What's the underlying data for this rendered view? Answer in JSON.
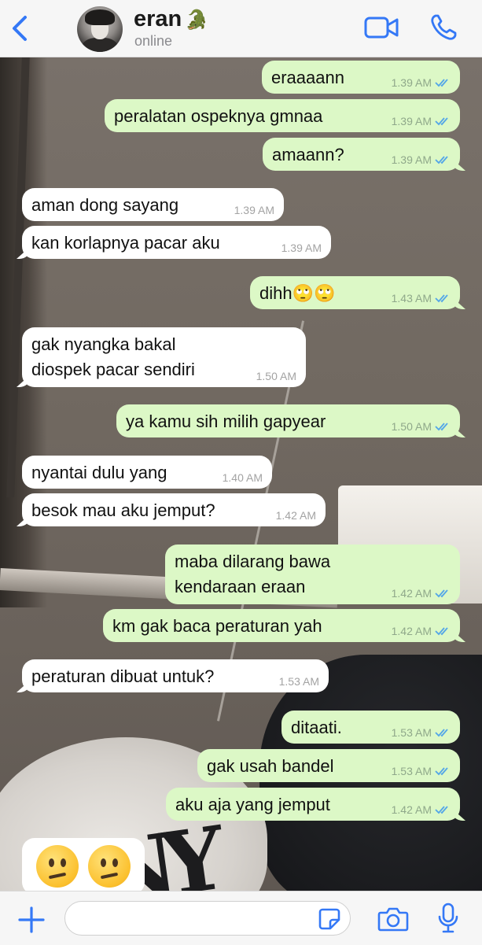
{
  "header": {
    "contact_name": "eran",
    "contact_name_emoji": "🐊",
    "status": "online",
    "icons": [
      "back-chevron-icon",
      "video-call-icon",
      "phone-call-icon"
    ],
    "accent_color": "#3478f6"
  },
  "messages": [
    {
      "direction": "out",
      "text": "eraaaann",
      "time": "1.39 AM",
      "read": true
    },
    {
      "direction": "out",
      "text": "peralatan ospeknya gmnaa",
      "time": "1.39 AM",
      "read": true
    },
    {
      "direction": "out",
      "text": "amaann?",
      "time": "1.39 AM",
      "read": true
    },
    {
      "direction": "in",
      "text": "aman dong sayang",
      "time": "1.39 AM"
    },
    {
      "direction": "in",
      "text": "kan korlapnya pacar aku",
      "time": "1.39 AM"
    },
    {
      "direction": "out",
      "text": "dihh🙄🙄",
      "time": "1.43 AM",
      "read": true
    },
    {
      "direction": "in",
      "text": "gak nyangka bakal\ndiospek pacar sendiri",
      "time": "1.50 AM"
    },
    {
      "direction": "out",
      "text": "ya kamu sih milih gapyear",
      "time": "1.50 AM",
      "read": true
    },
    {
      "direction": "in",
      "text": "nyantai dulu yang",
      "time": "1.40 AM"
    },
    {
      "direction": "in",
      "text": "besok mau aku jemput?",
      "time": "1.42 AM"
    },
    {
      "direction": "out",
      "text": "maba dilarang bawa\nkendaraan eraan",
      "time": "1.42 AM",
      "read": true
    },
    {
      "direction": "out",
      "text": "km gak baca peraturan yah",
      "time": "1.42 AM",
      "read": true
    },
    {
      "direction": "in",
      "text": "peraturan dibuat untuk?",
      "time": "1.53 AM"
    },
    {
      "direction": "out",
      "text": "ditaati.",
      "time": "1.53 AM",
      "read": true
    },
    {
      "direction": "out",
      "text": "gak usah bandel",
      "time": "1.53 AM",
      "read": true
    },
    {
      "direction": "out",
      "text": "aku aja yang jemput",
      "time": "1.42 AM",
      "read": true
    }
  ],
  "emoji_message": {
    "direction": "in",
    "emojis": [
      "confused-face-emoji",
      "confused-face-emoji"
    ]
  },
  "input_bar": {
    "placeholder": "",
    "value": "",
    "icons": [
      "plus-icon",
      "sticker-icon",
      "camera-icon",
      "microphone-icon"
    ]
  },
  "colors": {
    "outgoing_bubble": "#dcf8c6",
    "incoming_bubble": "#ffffff",
    "read_ticks": "#53a6e8"
  }
}
